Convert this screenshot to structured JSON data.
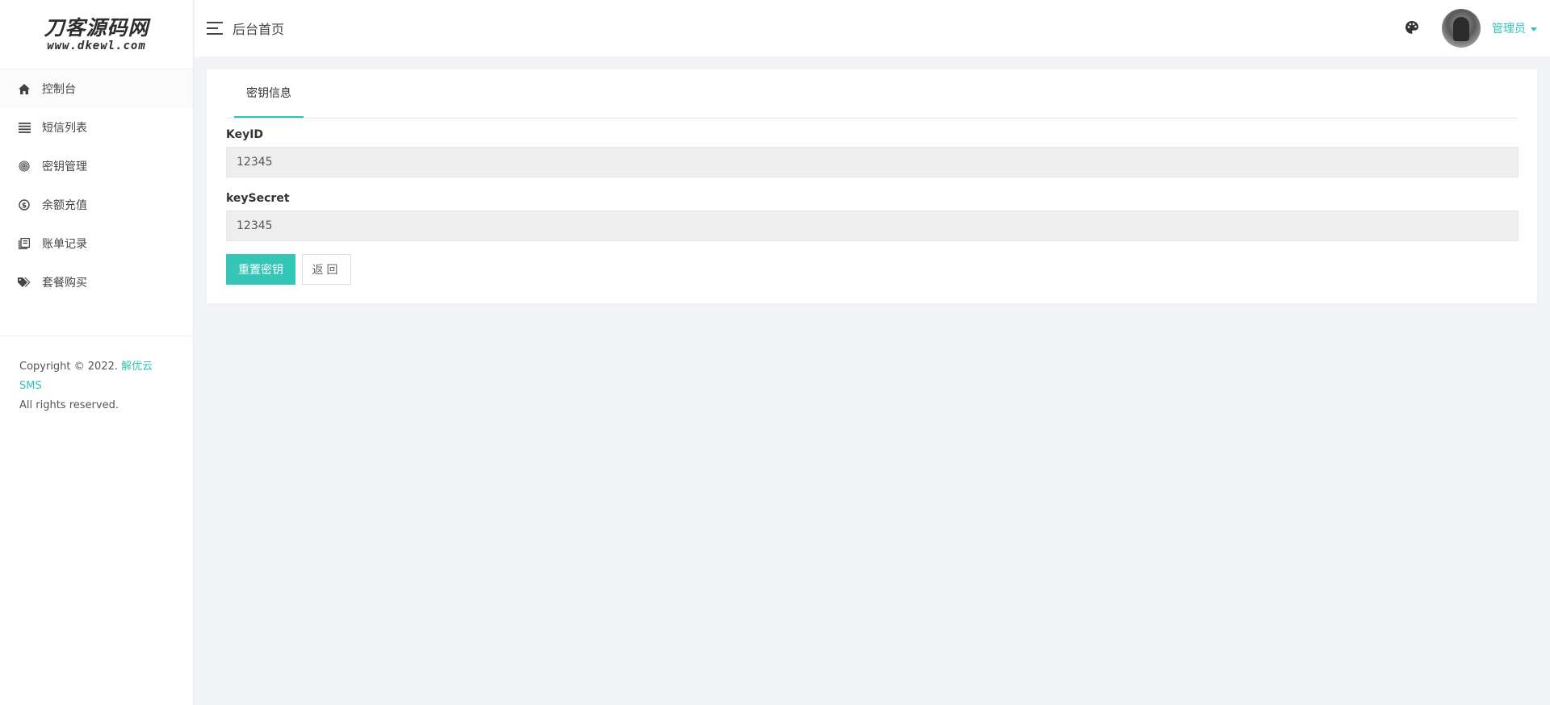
{
  "logo": {
    "main": "刀客源码网",
    "sub": "www.dkewl.com"
  },
  "sidebar": {
    "items": [
      {
        "label": "控制台",
        "icon": "home-icon"
      },
      {
        "label": "短信列表",
        "icon": "list-icon"
      },
      {
        "label": "密钥管理",
        "icon": "fingerprint-icon"
      },
      {
        "label": "余额充值",
        "icon": "dollar-circle-icon"
      },
      {
        "label": "账单记录",
        "icon": "book-icon"
      },
      {
        "label": "套餐购买",
        "icon": "tags-icon"
      }
    ],
    "copyright_prefix": "Copyright © 2022.",
    "copyright_brand": "解优云SMS",
    "copyright_suffix": "All rights reserved."
  },
  "header": {
    "title": "后台首页",
    "user_name": "管理员"
  },
  "main": {
    "tab_label": "密钥信息",
    "key_id_label": "KeyID",
    "key_id_value": "12345",
    "key_secret_label": "keySecret",
    "key_secret_value": "12345",
    "reset_button": "重置密钥",
    "back_button": "返回"
  },
  "colors": {
    "accent": "#36c6b8",
    "background": "#f3f4f8"
  }
}
